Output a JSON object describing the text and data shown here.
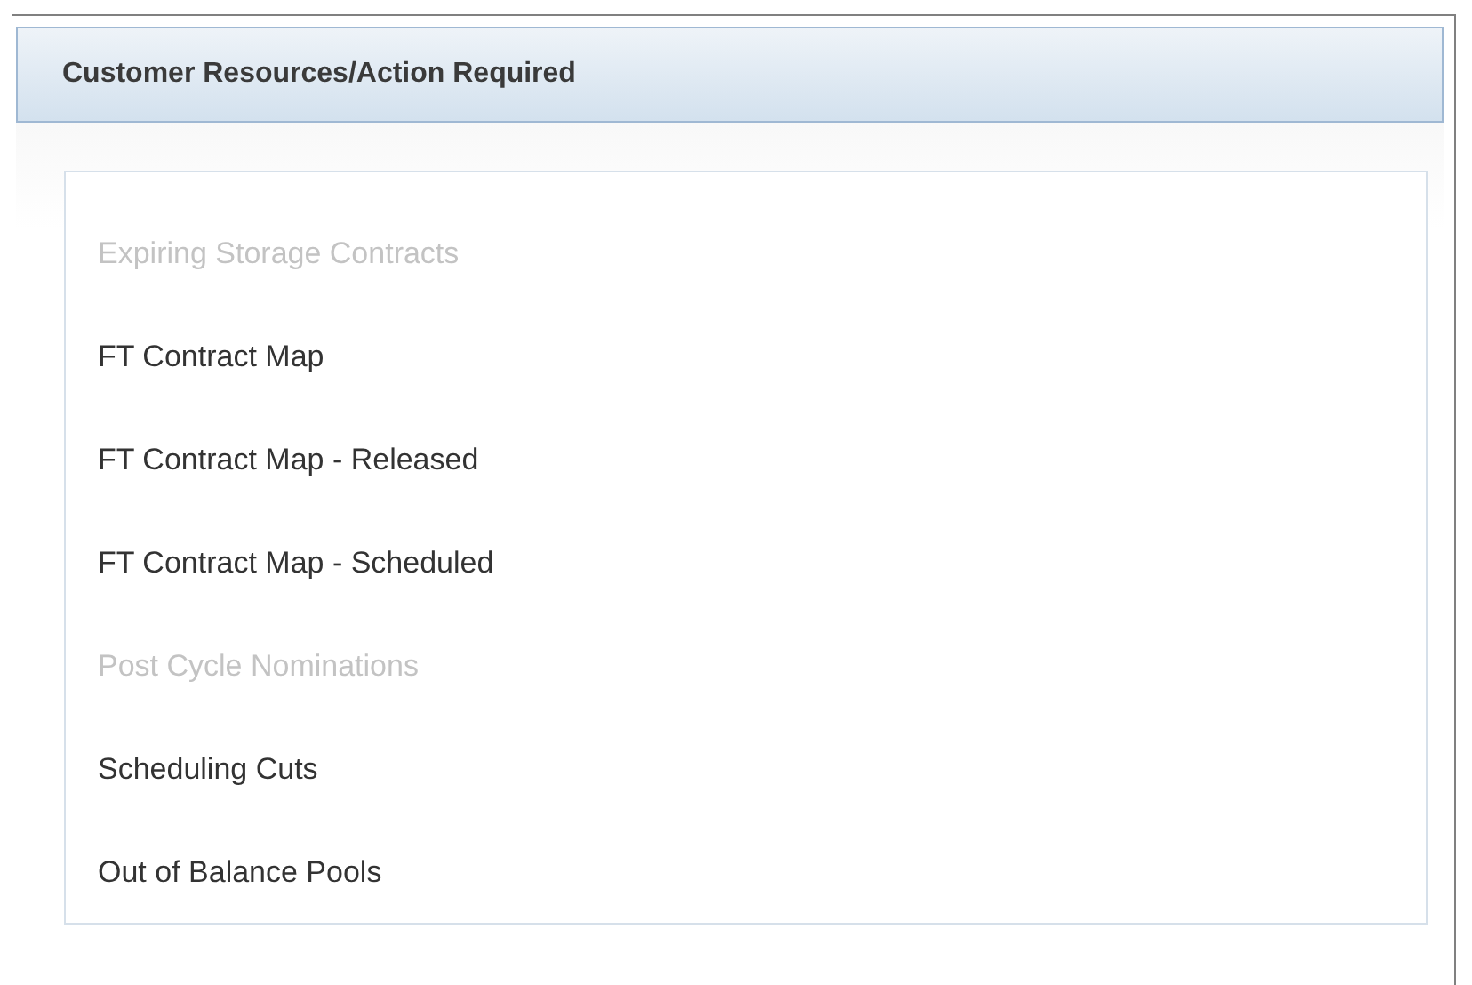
{
  "panel": {
    "title": "Customer Resources/Action Required"
  },
  "links": [
    {
      "label": "Expiring Storage Contracts",
      "disabled": true
    },
    {
      "label": "FT Contract Map",
      "disabled": false
    },
    {
      "label": "FT Contract Map - Released",
      "disabled": false
    },
    {
      "label": "FT Contract Map - Scheduled",
      "disabled": false
    },
    {
      "label": "Post Cycle Nominations",
      "disabled": true
    },
    {
      "label": "Scheduling Cuts",
      "disabled": false
    },
    {
      "label": "Out of Balance Pools",
      "disabled": false
    }
  ]
}
